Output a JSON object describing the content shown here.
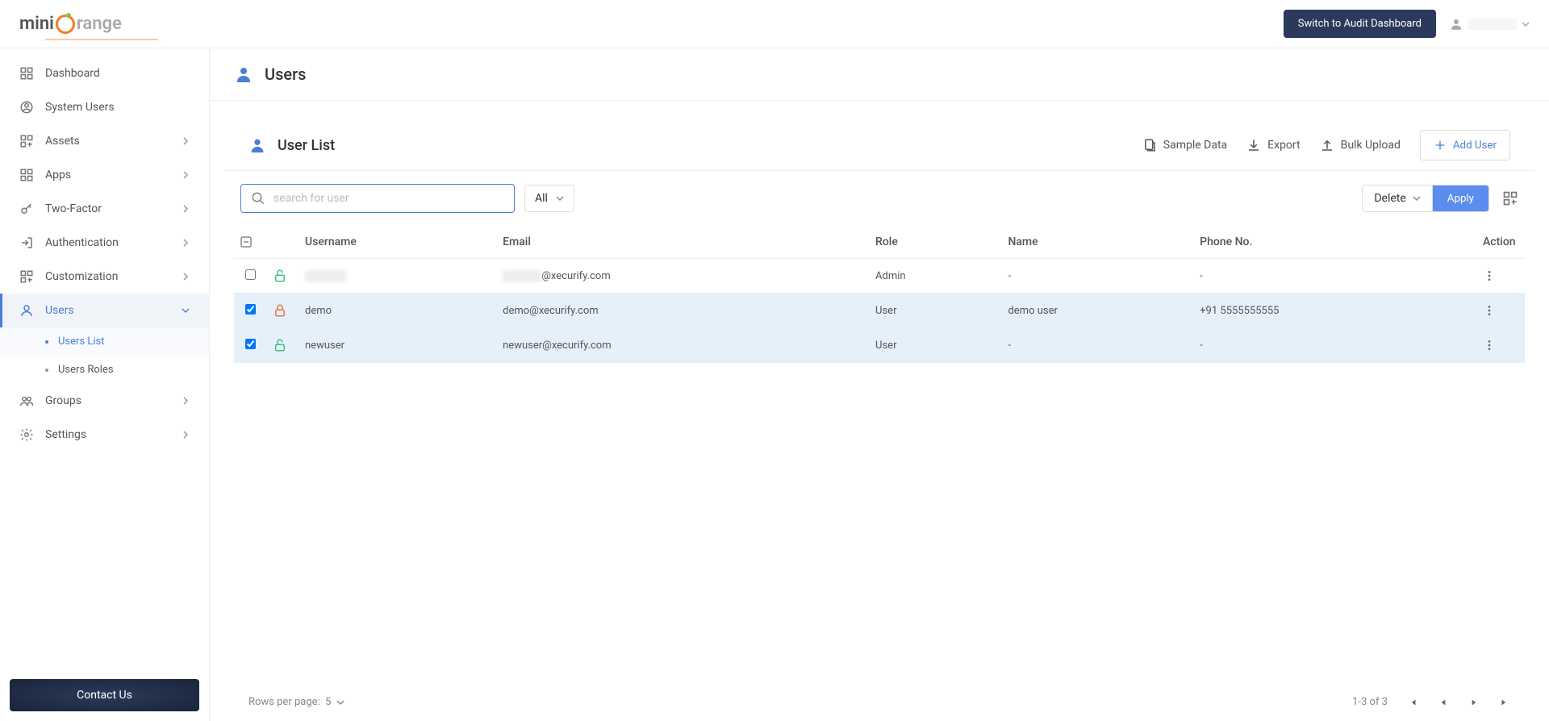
{
  "header": {
    "switch_button": "Switch to Audit Dashboard",
    "user_name": "———"
  },
  "sidebar": {
    "items": [
      {
        "label": "Dashboard",
        "expandable": false
      },
      {
        "label": "System Users",
        "expandable": false
      },
      {
        "label": "Assets",
        "expandable": true
      },
      {
        "label": "Apps",
        "expandable": true
      },
      {
        "label": "Two-Factor",
        "expandable": true
      },
      {
        "label": "Authentication",
        "expandable": true
      },
      {
        "label": "Customization",
        "expandable": true
      },
      {
        "label": "Users",
        "expandable": true,
        "active": true
      },
      {
        "label": "Groups",
        "expandable": true
      },
      {
        "label": "Settings",
        "expandable": true
      }
    ],
    "users_sub": [
      {
        "label": "Users List",
        "active": true
      },
      {
        "label": "Users Roles",
        "active": false
      }
    ],
    "contact": "Contact Us"
  },
  "page": {
    "title": "Users",
    "section_title": "User List",
    "actions": {
      "sample": "Sample Data",
      "export": "Export",
      "bulk": "Bulk Upload",
      "add": "Add User"
    },
    "search_placeholder": "search for user",
    "filter_all": "All",
    "delete": "Delete",
    "apply": "Apply"
  },
  "table": {
    "headers": {
      "username": "Username",
      "email": "Email",
      "role": "Role",
      "name": "Name",
      "phone": "Phone No.",
      "action": "Action"
    },
    "rows": [
      {
        "checked": false,
        "lock": "green",
        "username": "———",
        "email_suffix": "@xecurify.com",
        "role": "Admin",
        "name": "-",
        "phone": "-",
        "blurred": true
      },
      {
        "checked": true,
        "lock": "orange",
        "username": "demo",
        "email": "demo@xecurify.com",
        "role": "User",
        "name": "demo user",
        "phone": "+91 5555555555"
      },
      {
        "checked": true,
        "lock": "green",
        "username": "newuser",
        "email": "newuser@xecurify.com",
        "role": "User",
        "name": "-",
        "phone": "-"
      }
    ]
  },
  "footer": {
    "rows_label": "Rows per page:",
    "rows_value": "5",
    "range": "1-3 of 3"
  }
}
